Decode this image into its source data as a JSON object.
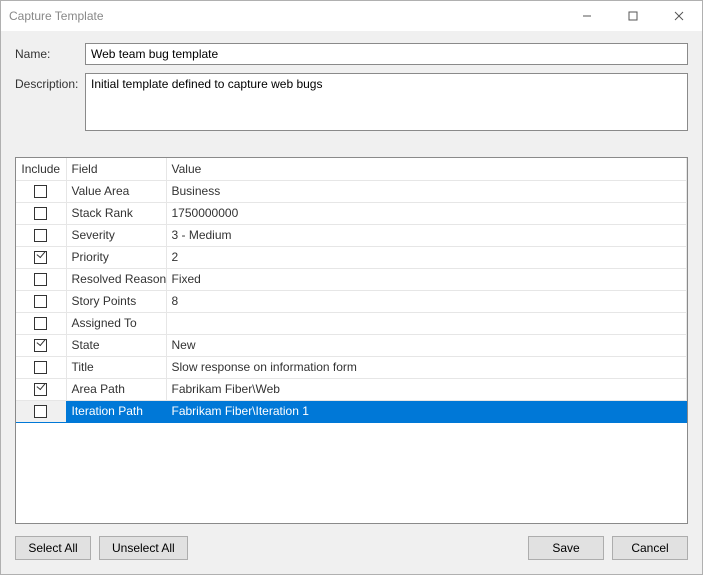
{
  "window": {
    "title": "Capture Template"
  },
  "labels": {
    "name": "Name:",
    "description": "Description:"
  },
  "fields": {
    "name": "Web team bug template",
    "description": "Initial template defined to capture web bugs"
  },
  "grid": {
    "headers": {
      "include": "Include",
      "field": "Field",
      "value": "Value"
    },
    "rows": [
      {
        "include": false,
        "field": "Value Area",
        "value": "Business",
        "selected": false
      },
      {
        "include": false,
        "field": "Stack Rank",
        "value": "1750000000",
        "selected": false
      },
      {
        "include": false,
        "field": "Severity",
        "value": "3 - Medium",
        "selected": false
      },
      {
        "include": true,
        "field": "Priority",
        "value": "2",
        "selected": false
      },
      {
        "include": false,
        "field": "Resolved Reason",
        "value": "Fixed",
        "selected": false
      },
      {
        "include": false,
        "field": "Story Points",
        "value": "8",
        "selected": false
      },
      {
        "include": false,
        "field": "Assigned To",
        "value": "",
        "selected": false
      },
      {
        "include": true,
        "field": "State",
        "value": "New",
        "selected": false
      },
      {
        "include": false,
        "field": "Title",
        "value": "Slow response on information form",
        "selected": false
      },
      {
        "include": true,
        "field": "Area Path",
        "value": "Fabrikam Fiber\\Web",
        "selected": false
      },
      {
        "include": false,
        "field": "Iteration Path",
        "value": "Fabrikam Fiber\\Iteration 1",
        "selected": true
      }
    ]
  },
  "buttons": {
    "selectAll": "Select All",
    "unselectAll": "Unselect All",
    "save": "Save",
    "cancel": "Cancel"
  }
}
